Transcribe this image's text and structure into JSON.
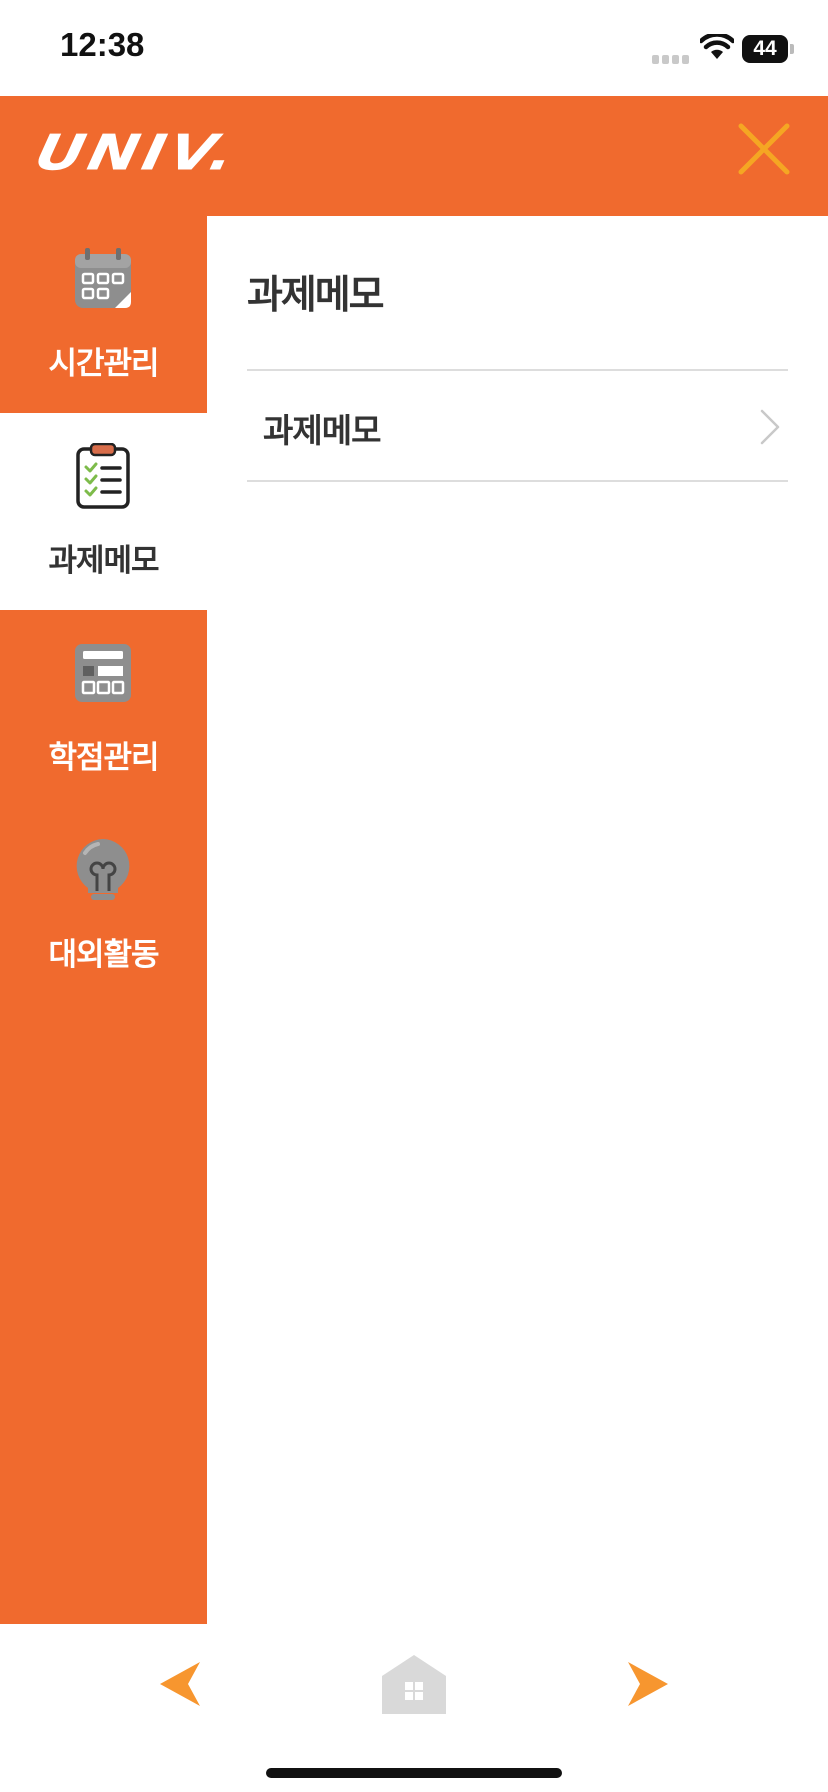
{
  "status_bar": {
    "time": "12:38",
    "battery": "44"
  },
  "header": {
    "logo": "UNIV.",
    "close_icon": "close-icon",
    "brand_color": "#f06a2e",
    "close_color": "#f5a623"
  },
  "sidebar": {
    "items": [
      {
        "label": "시간관리",
        "icon": "calendar-icon",
        "active": false
      },
      {
        "label": "과제메모",
        "icon": "clipboard-checklist-icon",
        "active": true
      },
      {
        "label": "학점관리",
        "icon": "calculator-icon",
        "active": false
      },
      {
        "label": "대외활동",
        "icon": "lightbulb-icon",
        "active": false
      }
    ]
  },
  "main": {
    "title": "과제메모",
    "list": [
      {
        "label": "과제메모"
      }
    ]
  },
  "bottom_nav": {
    "back_icon": "back-arrow-icon",
    "home_icon": "home-icon",
    "forward_icon": "forward-arrow-icon"
  }
}
